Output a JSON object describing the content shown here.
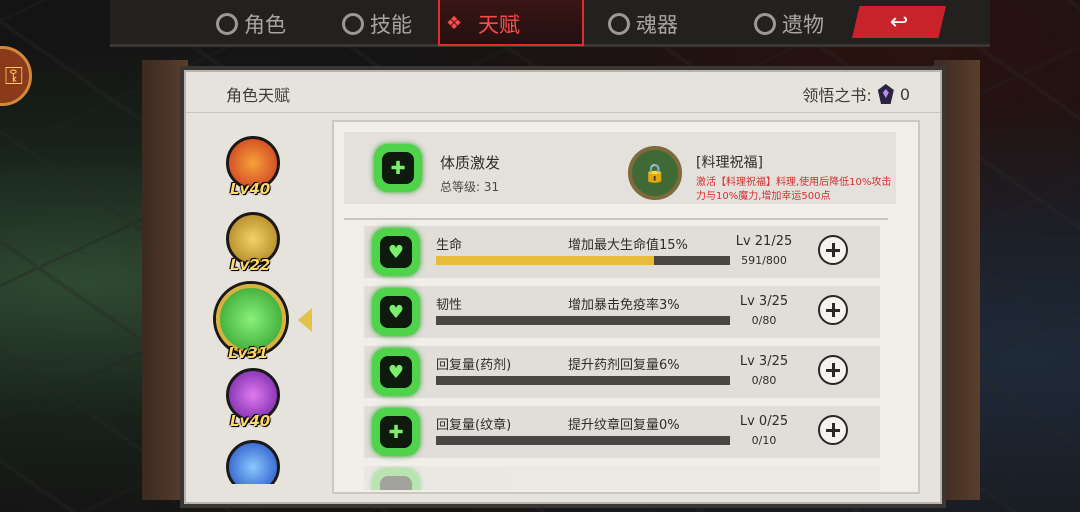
{
  "tabs": [
    {
      "label": "角色",
      "icon": "character-icon",
      "active": false
    },
    {
      "label": "技能",
      "icon": "skill-icon",
      "active": false
    },
    {
      "label": "天赋",
      "icon": "talent-icon",
      "active": true
    },
    {
      "label": "魂器",
      "icon": "soul-vessel-icon",
      "active": false
    },
    {
      "label": "遗物",
      "icon": "relic-icon",
      "active": false
    }
  ],
  "panel": {
    "title": "角色天赋",
    "book_label": "领悟之书:",
    "book_count": "0"
  },
  "classes": [
    {
      "name": "fire-class",
      "level": "Lv40",
      "color": "#e2452a",
      "selected": false
    },
    {
      "name": "shield-class",
      "level": "Lv22",
      "color": "#d8a52a",
      "selected": false
    },
    {
      "name": "constitution-class",
      "level": "Lv31",
      "color": "#3ec83a",
      "selected": true
    },
    {
      "name": "arcane-class",
      "level": "Lv40",
      "color": "#9a3ad0",
      "selected": false
    },
    {
      "name": "frost-class",
      "level": "",
      "color": "#2f6ad8",
      "selected": false
    }
  ],
  "summary": {
    "name": "体质激发",
    "total_level": "总等级:  31",
    "blessing_title": "[料理祝福]",
    "blessing_desc": "激活【料理祝福】料理,使用后降低10%攻击力与10%魔力,增加幸运500点"
  },
  "talents": [
    {
      "name": "生命",
      "desc": "增加最大生命值15%",
      "level": "Lv 21/25",
      "xp": "591/800",
      "progress": 0.74
    },
    {
      "name": "韧性",
      "desc": "增加暴击免疫率3%",
      "level": "Lv 3/25",
      "xp": "0/80",
      "progress": 0
    },
    {
      "name": "回复量(药剂)",
      "desc": "提升药剂回复量6%",
      "level": "Lv 3/25",
      "xp": "0/80",
      "progress": 0
    },
    {
      "name": "回复量(纹章)",
      "desc": "提升纹章回复量0%",
      "level": "Lv 0/25",
      "xp": "0/10",
      "progress": 0
    }
  ],
  "colors": {
    "accent": "#e02c2c",
    "progress": "#e8bb3b",
    "talent_green": "#4fd34a"
  }
}
